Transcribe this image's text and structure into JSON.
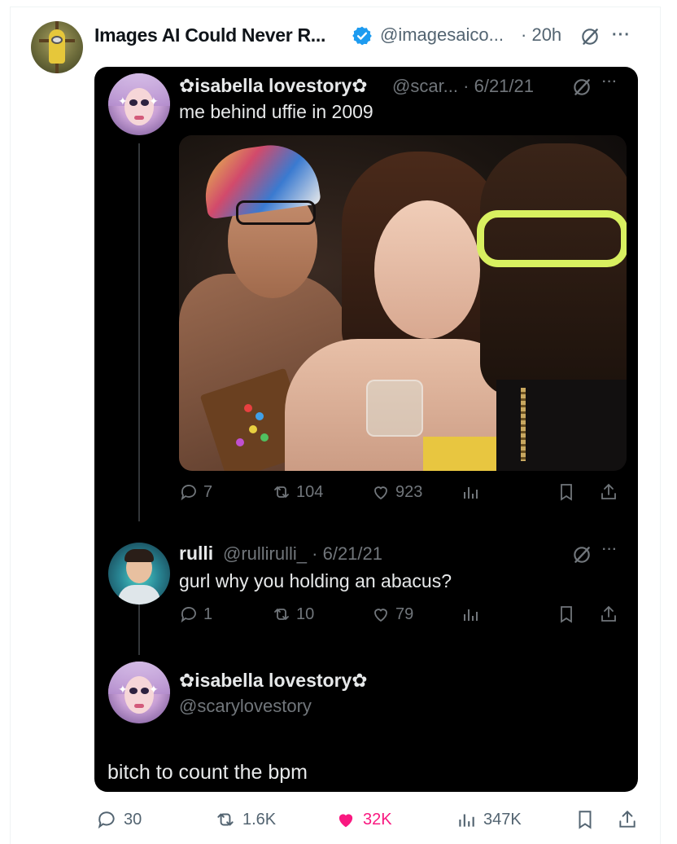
{
  "post": {
    "author_name": "Images AI Could Never R...",
    "author_handle": "@imagesaico...",
    "separator": "·",
    "time": "20h",
    "more": "···"
  },
  "screenshot": {
    "tweet1": {
      "name": "✿isabella lovestory✿",
      "handle": "@scar...",
      "date": "6/21/21",
      "text": "me behind uffie in 2009",
      "replies": "7",
      "reposts": "104",
      "likes": "923"
    },
    "tweet2": {
      "name": "rulli",
      "handle": "@rullirulli_",
      "date": "6/21/21",
      "text": "gurl why you holding an abacus?",
      "replies": "1",
      "reposts": "10",
      "likes": "79"
    },
    "tweet3": {
      "name": "✿isabella lovestory✿",
      "handle": "@scarylovestory",
      "text": "bitch to count the bpm"
    }
  },
  "actions": {
    "replies": "30",
    "reposts": "1.6K",
    "likes": "32K",
    "views": "347K",
    "liked": true,
    "like_color": "#f91880"
  },
  "colors": {
    "verified": "#1d9bf0",
    "dark_bg": "#000000",
    "muted": "#71767b"
  }
}
